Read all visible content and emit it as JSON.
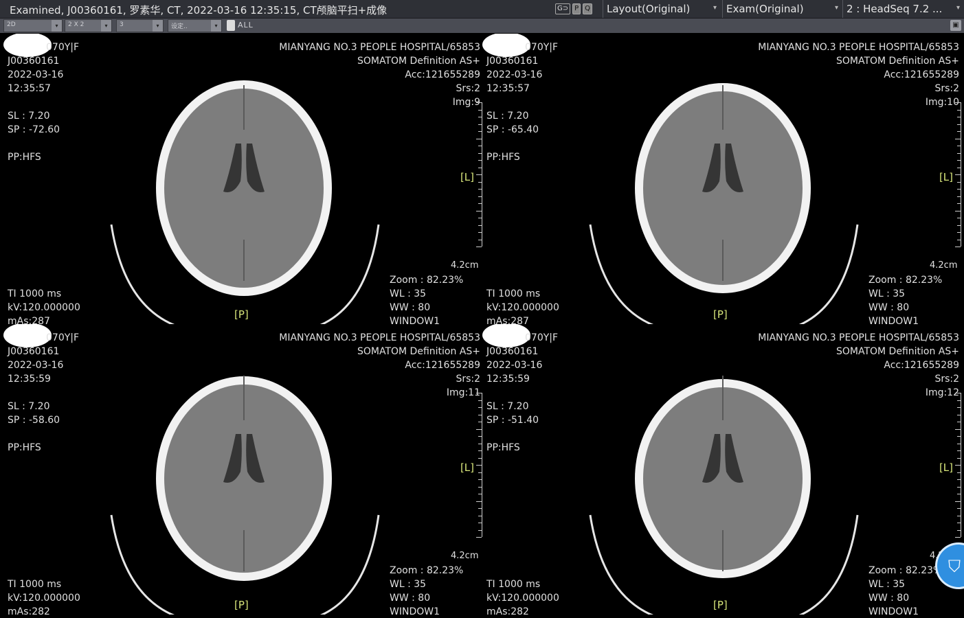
{
  "title": {
    "text": "Examined, J00360161, 罗素华, CT, 2022-03-16 12:35:15, CT颅脑平扫+成像",
    "link_icons": [
      "G⊃",
      "P",
      "Q"
    ],
    "layout_label": "Layout(Original)",
    "exam_label": "Exam(Original)",
    "series_label": "2 : HeadSeq  7.2  ...",
    "dropdown_glyph": "▾"
  },
  "toolbar": {
    "mode": "2D",
    "grid": "2 X 2",
    "value3": "3",
    "preset": "设定..",
    "dropdown_glyph": "▾",
    "all_label": "ALL",
    "right_icon": "▣"
  },
  "viewports": [
    {
      "id": "vp1",
      "patient": "070Y|F",
      "patient_id": "J00360161",
      "date": "2022-03-16",
      "time": "12:35:57",
      "sl": "SL : 7.20",
      "sp": "SP : -72.60",
      "pp": "PP:HFS",
      "hospital": "MIANYANG NO.3 PEOPLE HOSPITAL/65853",
      "scanner": "SOMATOM Definition AS+",
      "acc": "Acc:121655289",
      "srs": "Srs:2",
      "img": "Img:9",
      "ti": "TI 1000 ms",
      "kv": "kV:120.000000",
      "mas": "mAs:287",
      "zoom": "Zoom : 82.23%",
      "wl": "WL : 35",
      "ww": "WW : 80",
      "window": "WINDOW1",
      "orient_bottom": "[P]",
      "orient_right": "[L]",
      "scale": "4.2cm"
    },
    {
      "id": "vp2",
      "patient": "070Y|F",
      "patient_id": "J00360161",
      "date": "2022-03-16",
      "time": "12:35:57",
      "sl": "SL : 7.20",
      "sp": "SP : -65.40",
      "pp": "PP:HFS",
      "hospital": "MIANYANG NO.3 PEOPLE HOSPITAL/65853",
      "scanner": "SOMATOM Definition AS+",
      "acc": "Acc:121655289",
      "srs": "Srs:2",
      "img": "Img:10",
      "ti": "TI 1000 ms",
      "kv": "kV:120.000000",
      "mas": "mAs:287",
      "zoom": "Zoom : 82.23%",
      "wl": "WL : 35",
      "ww": "WW : 80",
      "window": "WINDOW1",
      "orient_bottom": "[P]",
      "orient_right": "[L]",
      "scale": "4.2cm"
    },
    {
      "id": "vp3",
      "patient": "070Y|F",
      "patient_id": "J00360161",
      "date": "2022-03-16",
      "time": "12:35:59",
      "sl": "SL : 7.20",
      "sp": "SP : -58.60",
      "pp": "PP:HFS",
      "hospital": "MIANYANG NO.3 PEOPLE HOSPITAL/65853",
      "scanner": "SOMATOM Definition AS+",
      "acc": "Acc:121655289",
      "srs": "Srs:2",
      "img": "Img:11",
      "ti": "TI 1000 ms",
      "kv": "kV:120.000000",
      "mas": "mAs:282",
      "zoom": "Zoom : 82.23%",
      "wl": "WL : 35",
      "ww": "WW : 80",
      "window": "WINDOW1",
      "orient_bottom": "[P]",
      "orient_right": "[L]",
      "scale": "4.2cm"
    },
    {
      "id": "vp4",
      "patient": "070Y|F",
      "patient_id": "J00360161",
      "date": "2022-03-16",
      "time": "12:35:59",
      "sl": "SL : 7.20",
      "sp": "SP : -51.40",
      "pp": "PP:HFS",
      "hospital": "MIANYANG NO.3 PEOPLE HOSPITAL/65853",
      "scanner": "SOMATOM Definition AS+",
      "acc": "Acc:121655289",
      "srs": "Srs:2",
      "img": "Img:12",
      "ti": "TI 1000 ms",
      "kv": "kV:120.000000",
      "mas": "mAs:282",
      "zoom": "Zoom : 82.23%",
      "wl": "WL : 35",
      "ww": "WW : 80",
      "window": "WINDOW1",
      "orient_bottom": "[P]",
      "orient_right": "[L]",
      "scale": "4.2cm"
    }
  ],
  "colors": {
    "orientation_marker": "#d7e57a",
    "overlay_text": "#e0e0e0",
    "security_badge": "#2f8fe0"
  },
  "floating": {
    "shield_icon": "⛉"
  }
}
